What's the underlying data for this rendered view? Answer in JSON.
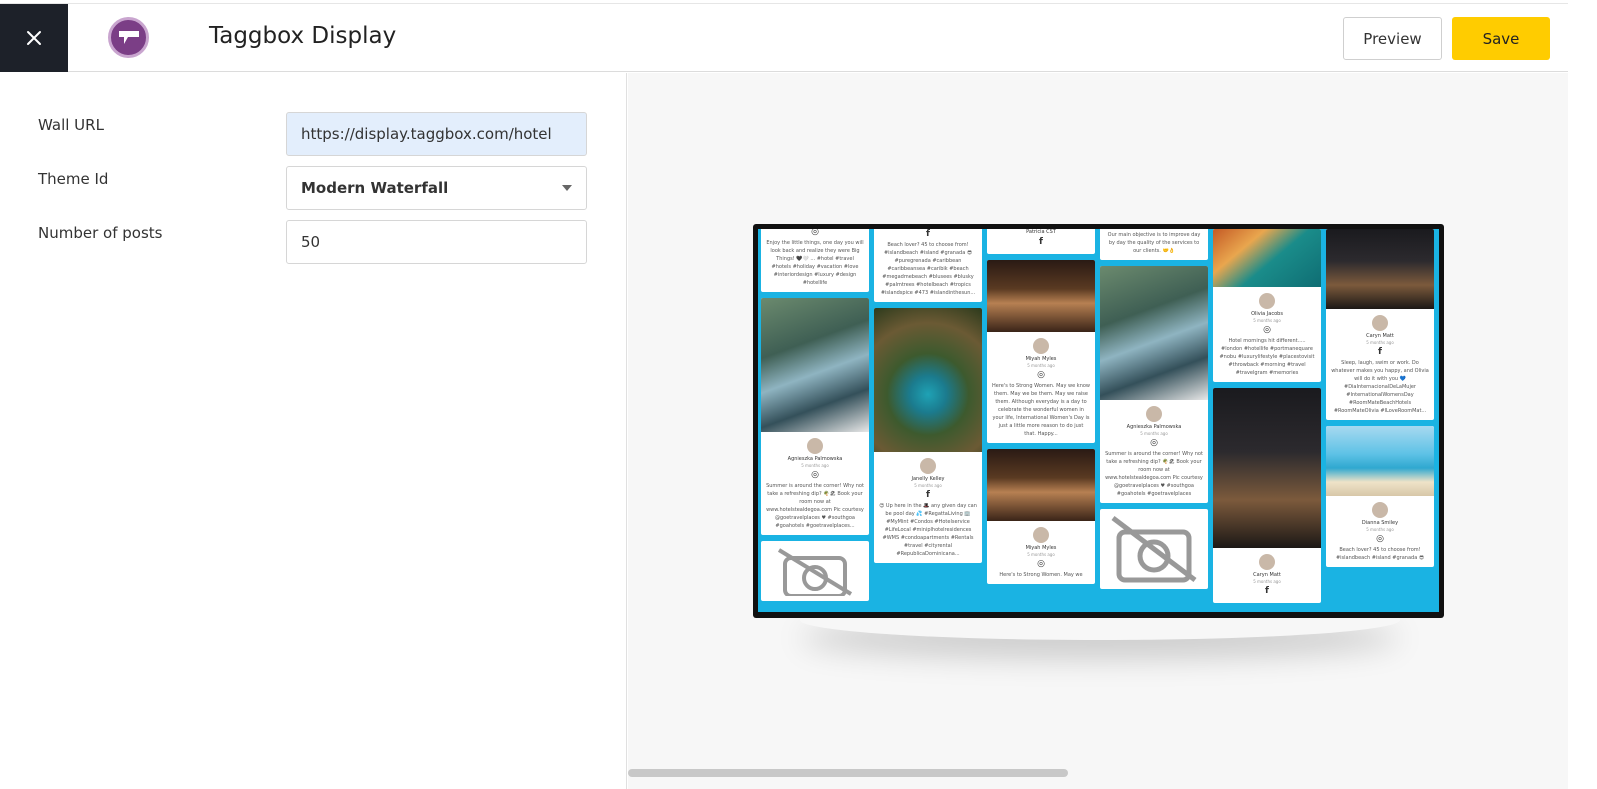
{
  "header": {
    "title": "Taggbox Display",
    "preview_label": "Preview",
    "save_label": "Save",
    "accent_color": "#ffcc00"
  },
  "form": {
    "wall_url_label": "Wall URL",
    "wall_url_value": "https://display.taggbox.com/hotel",
    "theme_label": "Theme Id",
    "theme_value": "Modern Waterfall",
    "posts_label": "Number of posts",
    "posts_value": "50"
  },
  "preview": {
    "wall_bg": "#1ab3e3",
    "cards": {
      "c1_caption": "Enjoy the little things, one day you will look back and realize they were Big Things! 🖤🤍 ... #hotel #travel #hotels #holiday #vacation #love #interiordesign #luxury #design #hotellife",
      "c2_author": "Agnieszka Palmowska",
      "c2_caption": "Summer is around the corner! Why not take a refreshing dip? 🌴🏖 Book your room now at www.hotelstealdegoa.com Pic courtesy @goetravelplaces ♥ #southgoa #goahotels #goetravelplaces...",
      "c3_caption": "Beach lover? 45 to choose from! #islandbeach #island #granada 😎 #puregrenada #caribbean #caribbeansea #caribik #beach #megadmebeach #blusees #blusky #palmtrees #hotelbeach #tropics #islandspice #473 #islandinthesun...",
      "c4_author": "Janelly Kelley",
      "c4_caption": "😍 Up here in the 🎩 any given day can be pool day 💦 #RegattaLiving 🏢 #MyMint #Condos #Hotelservice #LifeLocal #miniplhotelresidences #WMS #condoapartments #Rentals #travel #cityrental #RepublicaDominicana...",
      "c5_author": "Patricia CST",
      "c6_author": "Miyah Myles",
      "c6_caption": "Here's to Strong Women. May we know them. May we be them. May we raise them. Although everyday is a day to celebrate the wonderful women in your life, International Women's Day is just a little more reason to do just that. Happy...",
      "c7_author": "Miyah Myles",
      "c7_caption": "Here's to Strong Women. May we",
      "c8_caption": "Our main objective is to improve day by day the quality of the services to our clients. 🤝👌",
      "c9_author": "Agnieszka Palmowska",
      "c9_caption": "Summer is around the corner! Why not take a refreshing dip? 🌴🏖 Book your room now at www.hotelstealdegoa.com Pic courtesy @goetravelplaces ♥ #southgoa #goahotels #goetravelplaces",
      "c10_author": "Olivia Jacobs",
      "c10_caption": "Hotel mornings hit different..... #london #hotellife #portmanequare #nobu #luxurylifestyle #placestovisit #throwback #morning #travel #travelgram #memories",
      "c11_author": "Caryn Matt",
      "c12_author": "Caryn Matt",
      "c12_caption": "Sleep, laugh, swim or work. Do whatever makes you happy, and Olivia will do it with you 💙 #DiaInternacionalDeLaMujer #InternationalWomensDay #RoomMateBeachHotels #RoomMateOlivia #ILoveRoomMat...",
      "c13_author": "Dianna Smiley",
      "c13_caption": "Beach lover? 45 to choose from! #islandbeach #island #granada 😎",
      "meta": "5 months ago",
      "insta_glyph": "◎",
      "fb_glyph": "f"
    }
  }
}
